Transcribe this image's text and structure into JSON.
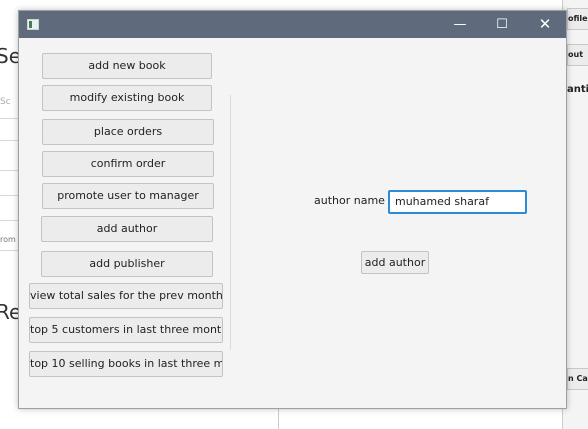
{
  "background_app": {
    "left_title_1": "Se",
    "left_title_2": "Re",
    "left_small_1": "Sc",
    "left_small_2": "rom",
    "right_button_1": "ofile",
    "right_button_2": "out",
    "right_text": "anti",
    "right_button_3": "n Car"
  },
  "window": {
    "icon": "java-app-icon",
    "controls": {
      "minimize": "—",
      "maximize": "☐",
      "close": "✕"
    }
  },
  "sidebar": {
    "buttons": [
      "add new book",
      "modify existing book",
      "place orders",
      "confirm order",
      "promote user to manager",
      "add author",
      "add publisher",
      "view total sales for the prev month",
      "top 5 customers in last three month...",
      "top 10 selling books in last three m..."
    ]
  },
  "form": {
    "author_label": "author name",
    "author_value": "muhamed sharaf",
    "submit_label": "add author"
  }
}
